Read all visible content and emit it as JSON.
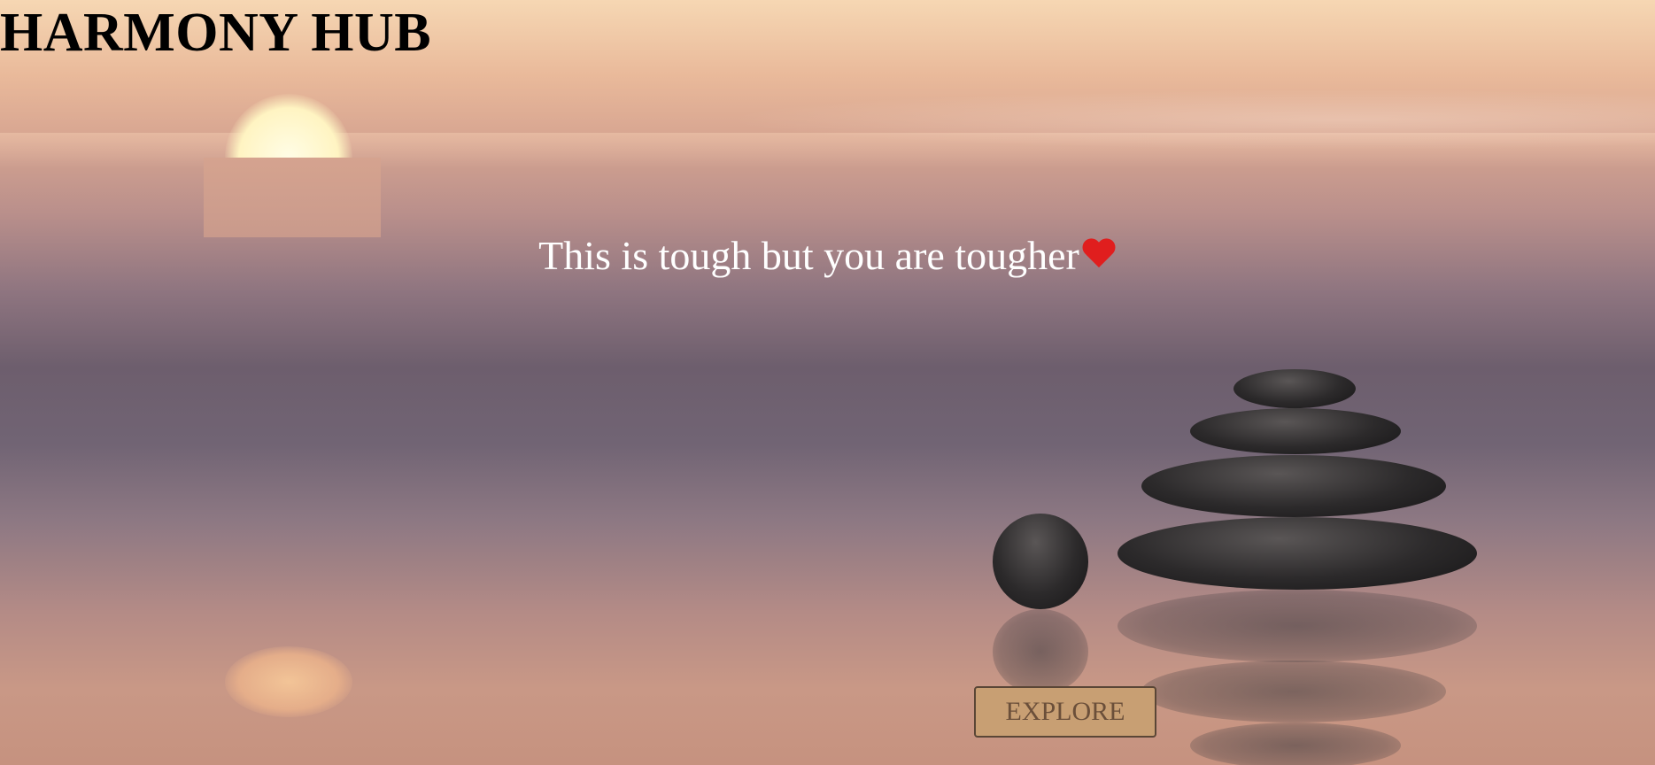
{
  "header": {
    "title": "HARMONY HUB"
  },
  "hero": {
    "tagline": "This is tough but you are tougher",
    "tagline_icon": "heart-icon",
    "background": "sunset-sea-stacked-stones-photo"
  },
  "actions": {
    "explore_label": "EXPLORE"
  },
  "colors": {
    "title": "#000000",
    "tagline": "#ffffff",
    "button_bg": "#c89f73",
    "button_text": "#6b4f3a",
    "heart": "#e01e1e"
  }
}
